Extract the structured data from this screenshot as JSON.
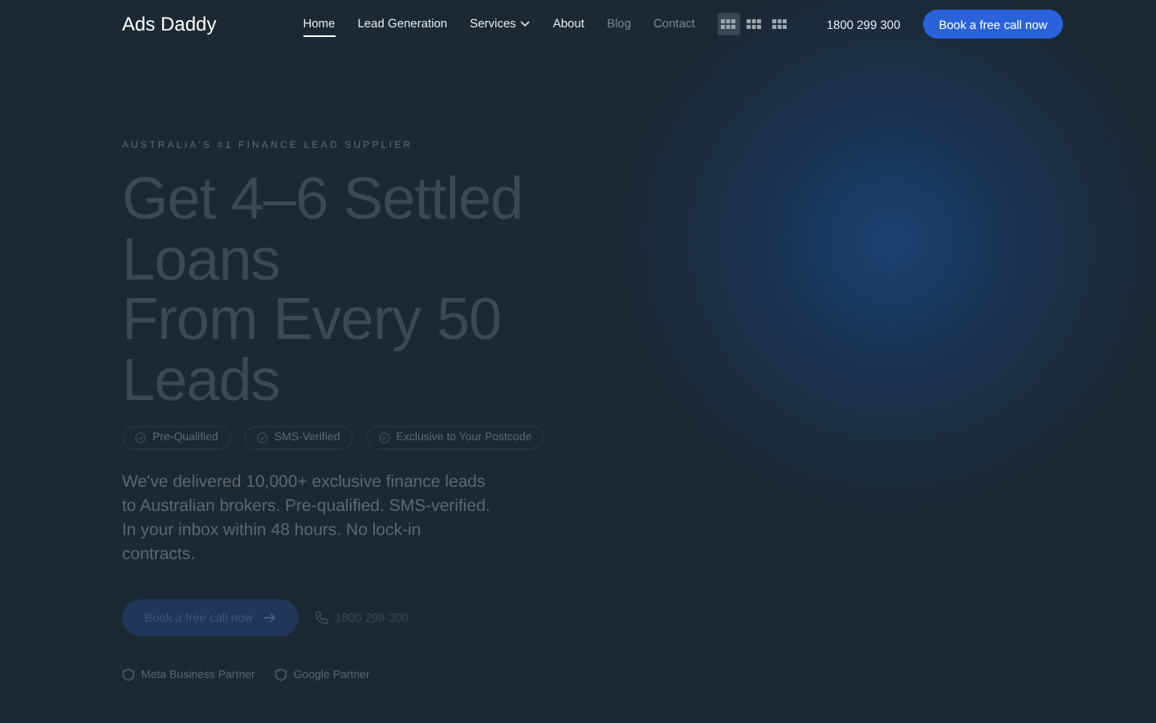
{
  "brand": "Ads Daddy",
  "nav": [
    {
      "label": "Home",
      "selected": true,
      "muted": false
    },
    {
      "label": "Lead Generation",
      "selected": false,
      "muted": false
    },
    {
      "label": "Services",
      "selected": false,
      "muted": false,
      "dropdown": true
    },
    {
      "label": "About",
      "selected": false,
      "muted": false
    },
    {
      "label": "Blog",
      "selected": false,
      "muted": true
    },
    {
      "label": "Contact",
      "selected": false,
      "muted": true
    }
  ],
  "view_toggles": [
    {
      "selected": true
    },
    {
      "selected": false
    },
    {
      "selected": false
    }
  ],
  "phone": "1800 299 300",
  "cta": "Book a free call now",
  "hero": {
    "eyebrow": "AUSTRALIA'S #1 FINANCE LEAD SUPPLIER",
    "headline_lines": [
      "Get 4–6 Settled",
      "Loans",
      "From Every 50",
      "Leads"
    ],
    "badges": [
      "Pre-Qualified",
      "SMS-Verified",
      "Exclusive to Your Postcode"
    ],
    "description": "We've delivered 10,000+ exclusive finance leads to Australian brokers. Pre-qualified. SMS-verified. In your inbox within 48 hours. No lock-in contracts.",
    "primary_button": "Book a free call now",
    "phone": "1800 299 300",
    "partners": [
      "Meta Business Partner",
      "Google Partner"
    ]
  }
}
